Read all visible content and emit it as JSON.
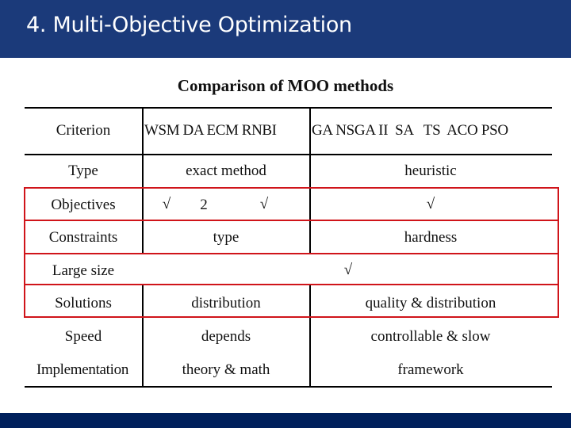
{
  "slide": {
    "title": "4. Multi-Objective Optimization",
    "colors": {
      "header_bar": "#1b3a7a",
      "footer_bar": "#00205c",
      "highlight_box": "#d0141a"
    }
  },
  "table": {
    "title": "Comparison of MOO methods",
    "header": {
      "criterion": "Criterion",
      "exact_methods": "WSM DA ECM RNBI",
      "heuristic_methods": "GA NSGA II  SA   TS  ACO PSO"
    },
    "rows": [
      {
        "criterion": "Type",
        "exact": "exact method",
        "heuristic": "heuristic"
      },
      {
        "criterion": "Objectives",
        "exact_parts": [
          "√",
          "2",
          "√"
        ],
        "heuristic": "√",
        "highlighted": true
      },
      {
        "criterion": "Constraints",
        "exact": "type",
        "heuristic": "hardness",
        "highlighted": true
      },
      {
        "criterion": "Large size",
        "merged": "√",
        "highlighted": true
      },
      {
        "criterion": "Solutions",
        "exact": "distribution",
        "heuristic": "quality & distribution",
        "highlighted": true
      },
      {
        "criterion": "Speed",
        "exact": "depends",
        "heuristic": "controllable & slow"
      },
      {
        "criterion": "Implementation",
        "exact": "theory & math",
        "heuristic": "framework"
      }
    ]
  }
}
